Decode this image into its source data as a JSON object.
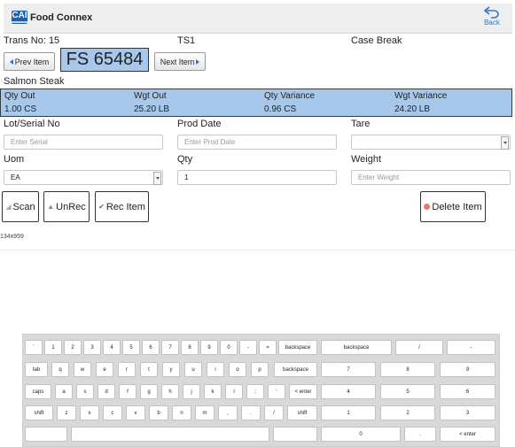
{
  "header": {
    "brand_mark": "CAI",
    "brand": "Food Connex",
    "back_label": "Back"
  },
  "trans": {
    "trans_no": "Trans No: 15",
    "station": "TS1",
    "mode": "Case Break"
  },
  "nav": {
    "prev_label": "Prev Item",
    "item_code": "FS 65484",
    "next_label": "Next Item"
  },
  "product_name": "Salmon Steak",
  "summary": {
    "headers": [
      "Qty Out",
      "Wgt Out",
      "Qty Variance",
      "Wgt Variance"
    ],
    "values": [
      "1.00 CS",
      "25.20 LB",
      "0.96 CS",
      "24.20 LB"
    ]
  },
  "form": {
    "lot_label": "Lot/Serial No",
    "lot_placeholder": "Enter Serial",
    "prod_date_label": "Prod Date",
    "prod_date_placeholder": "Enter Prod Date",
    "tare_label": "Tare",
    "tare_value": "",
    "uom_label": "Uom",
    "uom_value": "EA",
    "qty_label": "Qty",
    "qty_value": "1",
    "weight_label": "Weight",
    "weight_placeholder": "Enter Weight"
  },
  "actions": {
    "scan": "Scan",
    "unrec": "UnRec",
    "rec_item": "Rec Item",
    "delete_item": "Delete Item"
  },
  "resolution": "134x959",
  "keyboard": {
    "rows": [
      [
        "`",
        "1",
        "2",
        "3",
        "4",
        "5",
        "6",
        "7",
        "8",
        "9",
        "0",
        "-",
        "=",
        "backspace"
      ],
      [
        "tab",
        "q",
        "w",
        "e",
        "r",
        "t",
        "y",
        "u",
        "i",
        "o",
        "p",
        "backspace"
      ],
      [
        "caps",
        "a",
        "s",
        "d",
        "f",
        "g",
        "h",
        "j",
        "k",
        "l",
        ";",
        "'",
        "< enter"
      ],
      [
        "shift",
        "z",
        "x",
        "c",
        "v",
        "b",
        "n",
        "m",
        ",",
        ".",
        "/",
        "shift"
      ],
      [
        "",
        "",
        ""
      ]
    ],
    "numpad": [
      [
        "backspace",
        "/",
        "-"
      ],
      [
        "7",
        "8",
        "9"
      ],
      [
        "4",
        "5",
        "6"
      ],
      [
        "1",
        "2",
        "3"
      ],
      [
        "0",
        ".",
        "< enter"
      ]
    ]
  }
}
